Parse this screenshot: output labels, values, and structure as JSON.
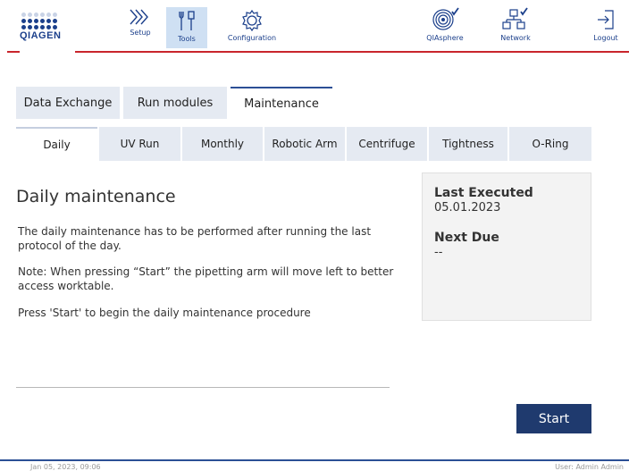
{
  "header": {
    "logo_text": "QIAGEN",
    "nav": {
      "setup": "Setup",
      "tools": "Tools",
      "configuration": "Configuration",
      "qiasphere": "QIAsphere",
      "network": "Network",
      "logout": "Logout"
    },
    "active_nav": "Tools",
    "accent_color": "#c9252c",
    "brand_color": "#1b3f8b"
  },
  "main_tabs": [
    "Data Exchange",
    "Run modules",
    "Maintenance"
  ],
  "active_main_tab": "Maintenance",
  "sub_tabs": [
    "Daily",
    "UV Run",
    "Monthly",
    "Robotic Arm",
    "Centrifuge",
    "Tightness",
    "O-Ring"
  ],
  "active_sub_tab": "Daily",
  "content": {
    "title": "Daily maintenance",
    "paragraphs": [
      "The daily maintenance has to be performed after running the last protocol of the day.",
      "Note: When pressing “Start” the pipetting arm will move left to better access worktable.",
      "Press 'Start' to begin the daily maintenance procedure"
    ]
  },
  "status_panel": {
    "last_executed_label": "Last Executed",
    "last_executed_value": "05.01.2023",
    "next_due_label": "Next Due",
    "next_due_value": "--"
  },
  "start_button": "Start",
  "footer": {
    "datetime": "Jan 05, 2023, 09:06",
    "user": "User: Admin Admin"
  }
}
